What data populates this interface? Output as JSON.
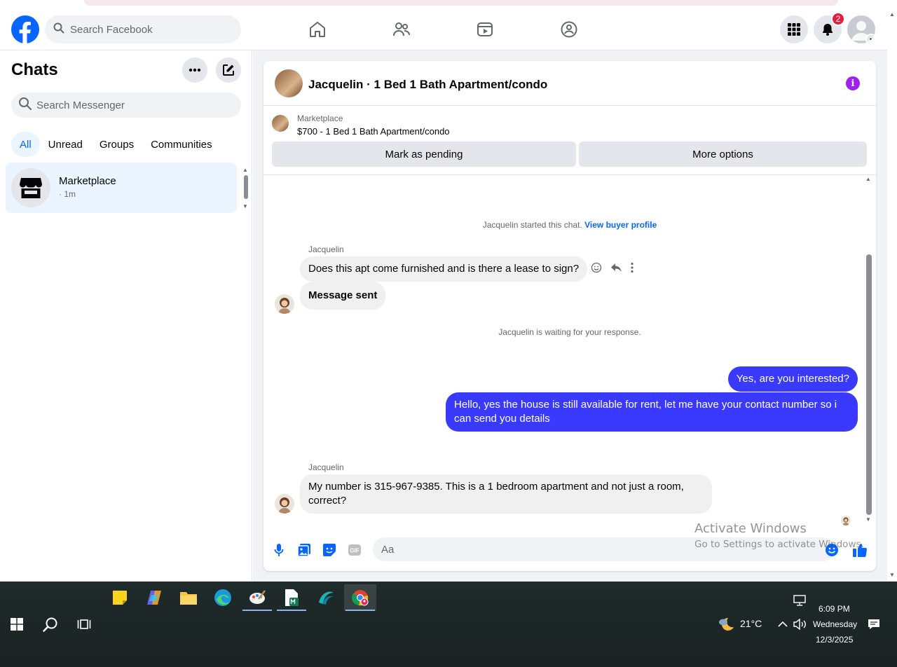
{
  "header": {
    "search_placeholder": "Search Facebook",
    "notification_count": "2"
  },
  "sidebar": {
    "title": "Chats",
    "search_placeholder": "Search Messenger",
    "filters": [
      "All",
      "Unread",
      "Groups",
      "Communities"
    ],
    "active_filter": "All",
    "chat": {
      "name": "Marketplace",
      "time": "· 1m"
    }
  },
  "conversation": {
    "title": "Jacquelin · 1 Bed 1 Bath Apartment/condo",
    "listing_label": "Marketplace",
    "listing_title": "$700 - 1 Bed 1 Bath Apartment/condo",
    "mark_pending": "Mark as pending",
    "more_options": "More options",
    "started_text": "Jacquelin started this chat.",
    "view_profile": "View buyer profile",
    "sender1": "Jacquelin",
    "msg1": "Does this apt come furnished and is there a lease to sign?",
    "msg2": "Message sent",
    "waiting": "Jacquelin is waiting for your response.",
    "out1": "Yes, are you interested?",
    "out2": "Hello, yes the house is still available for rent, let me have your contact number so i can send you details",
    "sender2": "Jacquelin",
    "msg3": "My number is 315-967-9385. This is a 1 bedroom apartment and not just a room, correct?",
    "composer_placeholder": "Aa",
    "gif_label": "GIF"
  },
  "watermark": {
    "line1": "Activate Windows",
    "line2": "Go to Settings to activate Windows."
  },
  "taskbar": {
    "weather": "21°C",
    "time": "6:09 PM",
    "day": "Wednesday",
    "date": "12/3/2025"
  },
  "colors": {
    "fb_blue": "#0866ff",
    "outgoing_bubble": "#3a3aff",
    "incoming_bubble": "#f0f0f0",
    "badge_red": "#e41e3f",
    "info_purple": "#a020f0"
  }
}
